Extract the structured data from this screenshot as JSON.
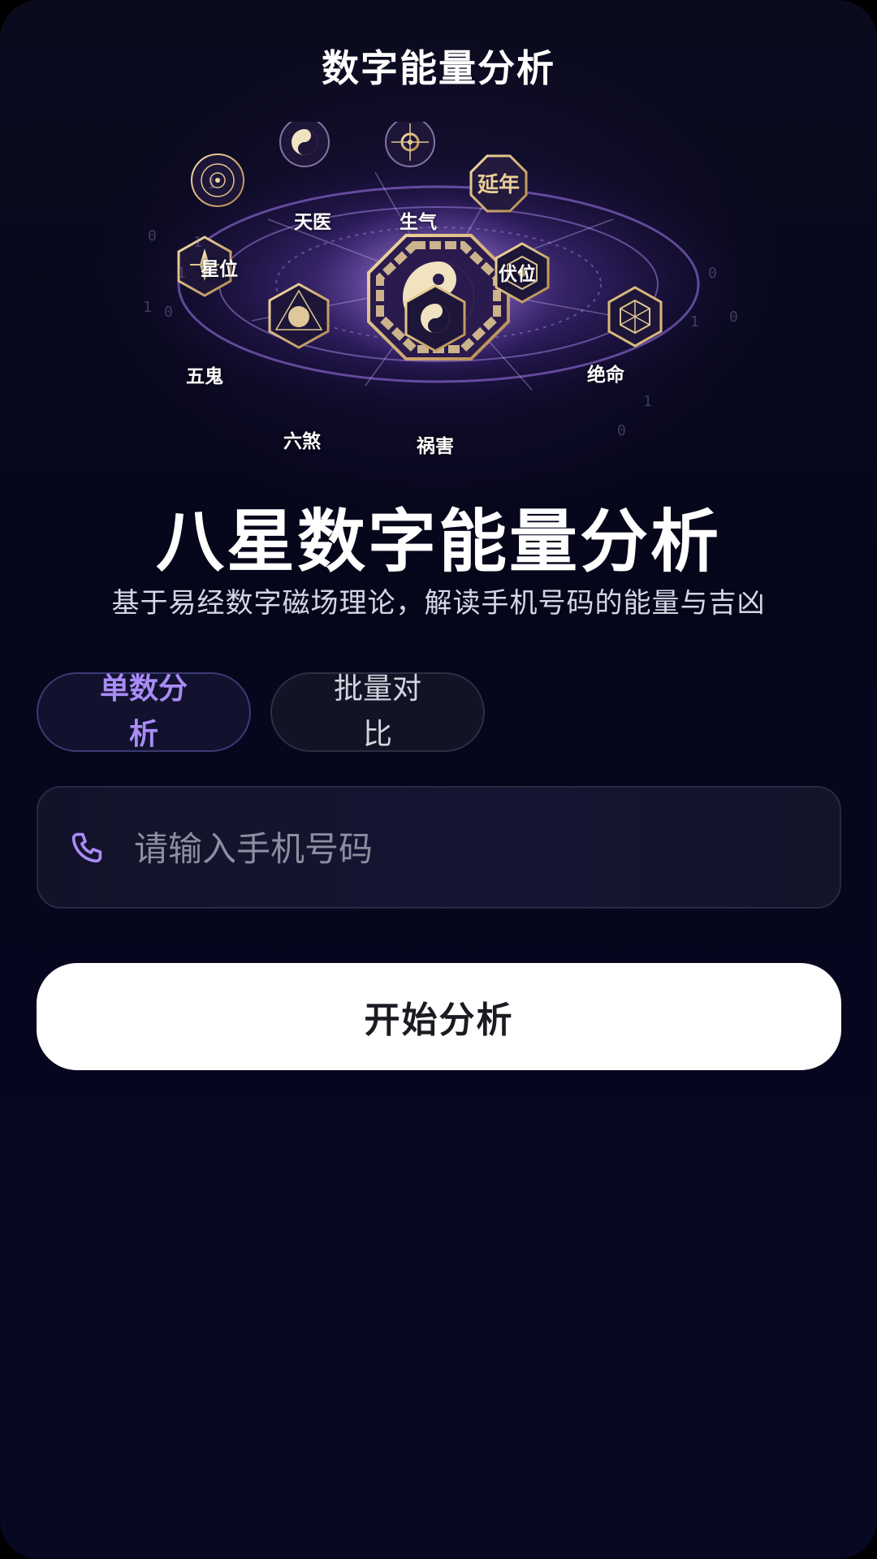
{
  "header": {
    "title": "数字能量分析"
  },
  "hero": {
    "stars": [
      "天医",
      "生气",
      "延年",
      "星位",
      "伏位",
      "五鬼",
      "绝命",
      "六煞",
      "祸害"
    ],
    "badge_text": "延年",
    "bg_digits": [
      "1",
      "0",
      "1",
      "1",
      "0",
      "1",
      "0",
      "1",
      "0",
      "1",
      "0"
    ]
  },
  "main": {
    "headline": "八星数字能量分析",
    "subtitle": "基于易经数字磁场理论，解读手机号码的能量与吉凶"
  },
  "tabs": [
    {
      "label": "单数分析",
      "active": true
    },
    {
      "label": "批量对比",
      "active": false
    }
  ],
  "phone": {
    "placeholder": "请输入手机号码",
    "value": ""
  },
  "actions": {
    "start_label": "开始分析"
  },
  "colors": {
    "accent": "#a98cf6",
    "background": "#06061b",
    "gold": "#d9b97a",
    "button_bg": "#ffffff"
  },
  "icons": {
    "phone": "phone-icon",
    "center": "yin-yang-bagua-icon"
  }
}
